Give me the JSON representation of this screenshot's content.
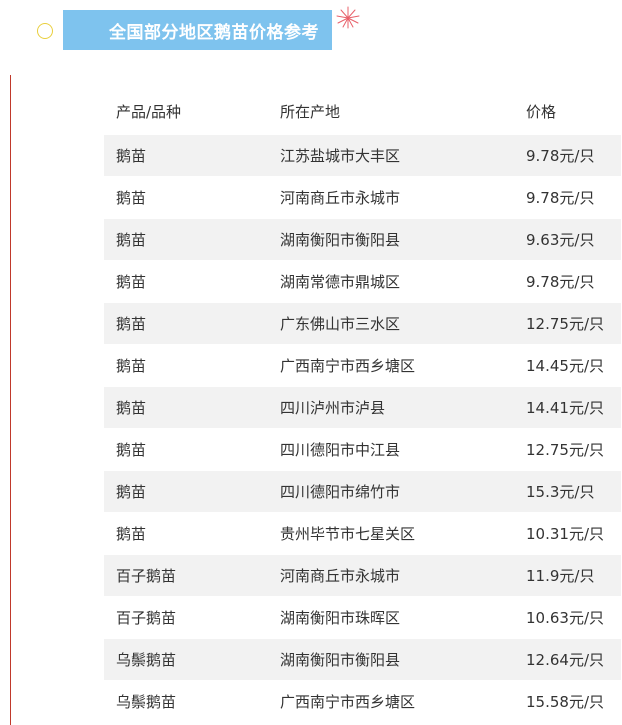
{
  "header": {
    "title": "全国部分地区鹅苗价格参考"
  },
  "table": {
    "headers": [
      "产品/品种",
      "所在产地",
      "价格"
    ],
    "rows": [
      [
        "鹅苗",
        "江苏盐城市大丰区",
        "9.78元/只"
      ],
      [
        "鹅苗",
        "河南商丘市永城市",
        "9.78元/只"
      ],
      [
        "鹅苗",
        "湖南衡阳市衡阳县",
        "9.63元/只"
      ],
      [
        "鹅苗",
        "湖南常德市鼎城区",
        "9.78元/只"
      ],
      [
        "鹅苗",
        "广东佛山市三水区",
        "12.75元/只"
      ],
      [
        "鹅苗",
        "广西南宁市西乡塘区",
        "14.45元/只"
      ],
      [
        "鹅苗",
        "四川泸州市泸县",
        "14.41元/只"
      ],
      [
        "鹅苗",
        "四川德阳市中江县",
        "12.75元/只"
      ],
      [
        "鹅苗",
        "四川德阳市绵竹市",
        "15.3元/只"
      ],
      [
        "鹅苗",
        "贵州毕节市七星关区",
        "10.31元/只"
      ],
      [
        "百子鹅苗",
        "河南商丘市永城市",
        "11.9元/只"
      ],
      [
        "百子鹅苗",
        "湖南衡阳市珠晖区",
        "10.63元/只"
      ],
      [
        "乌鬃鹅苗",
        "湖南衡阳市衡阳县",
        "12.64元/只"
      ],
      [
        "乌鬃鹅苗",
        "广西南宁市西乡塘区",
        "15.58元/只"
      ]
    ]
  },
  "colors": {
    "banner": "#7ec3ee",
    "stripe": "#f2f2f2",
    "rule": "#c0392b",
    "circle": "#e9cf3e",
    "burst": "#e8606a"
  }
}
